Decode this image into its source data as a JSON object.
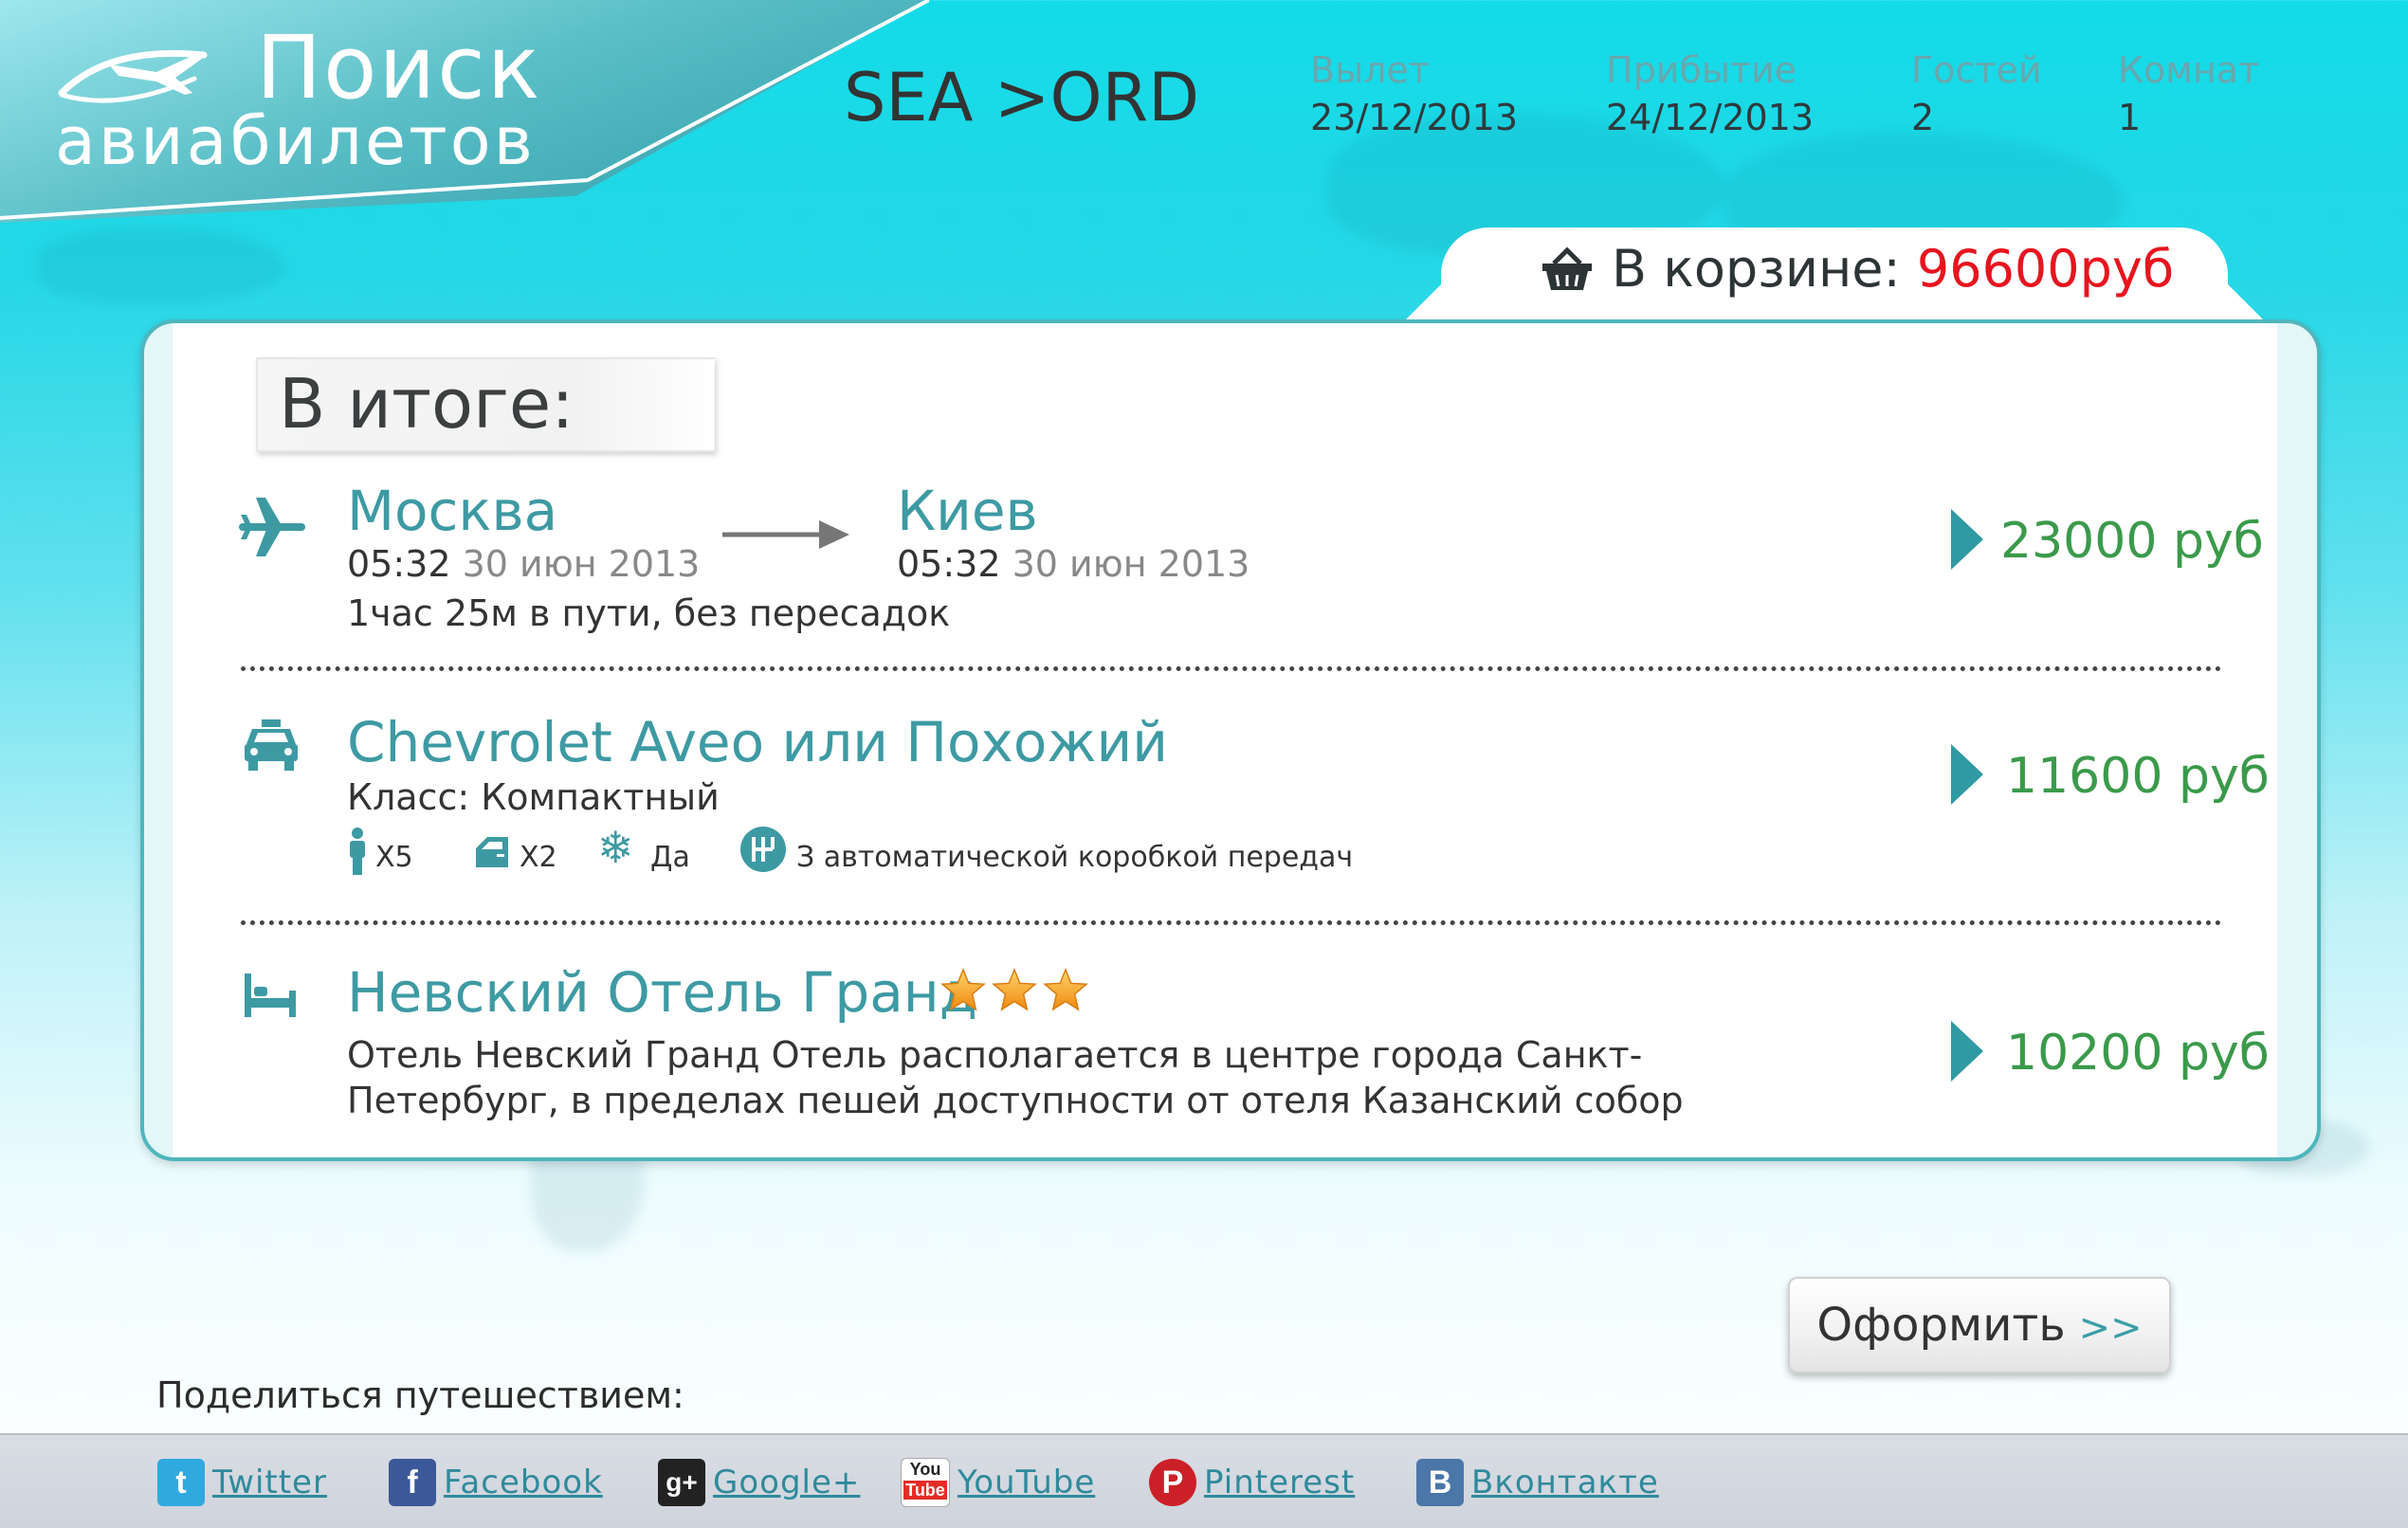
{
  "brand": {
    "title_line1": "Поиск",
    "title_line2": "авиабилетов"
  },
  "header": {
    "route": "SEA >ORD",
    "departure_label": "Вылет",
    "departure_value": "23/12/2013",
    "arrival_label": "Прибытие",
    "arrival_value": "24/12/2013",
    "guests_label": "Гостей",
    "guests_value": "2",
    "rooms_label": "Комнат",
    "rooms_value": "1"
  },
  "cart": {
    "label": "В корзине:",
    "total": "96600руб",
    "icon": "basket-icon"
  },
  "summary": {
    "title": "В итоге:",
    "flight": {
      "icon": "plane-icon",
      "from_city": "Москва",
      "from_time": "05:32",
      "from_date": "30 июн 2013",
      "to_city": "Киев",
      "to_time": "05:32",
      "to_date": "30 июн 2013",
      "duration": "1час 25м в пути, без пересадок",
      "price": "23000 руб"
    },
    "car": {
      "icon": "taxi-icon",
      "title": "Chevrolet Aveo или Похожий",
      "class": "Класс: Компактный",
      "passengers": "X5",
      "doors": "X2",
      "ac": "Да",
      "transmission": "З автоматической коробкой передач",
      "price": "11600 руб"
    },
    "hotel": {
      "icon": "bed-icon",
      "title": "Невский Отель Гранд",
      "stars": 3,
      "description": "Отель Невский Гранд Отель располагается в центре города Санкт-Петербург, в пределах пешей доступности от отеля Казанский собор",
      "price": "10200 руб"
    }
  },
  "order_button": {
    "label": "Оформить",
    "arrows": ">>"
  },
  "share": {
    "label": "Поделиться путешествием:",
    "links": [
      {
        "label": "Twitter",
        "icon": "twitter-icon",
        "color": "#2fa9e0"
      },
      {
        "label": "Facebook",
        "icon": "facebook-icon",
        "color": "#3b5998"
      },
      {
        "label": "Google+",
        "icon": "google-plus-icon",
        "color": "#222222"
      },
      {
        "label": "YouTube",
        "icon": "youtube-icon",
        "color": "#e52d27"
      },
      {
        "label": "Pinterest",
        "icon": "pinterest-icon",
        "color": "#cb2027"
      },
      {
        "label": "Вконтакте",
        "icon": "vk-icon",
        "color": "#4a76a8"
      }
    ]
  },
  "colors": {
    "accent": "#3d9aa3",
    "price": "#3a9a4a",
    "cart_total": "#e8141e"
  }
}
